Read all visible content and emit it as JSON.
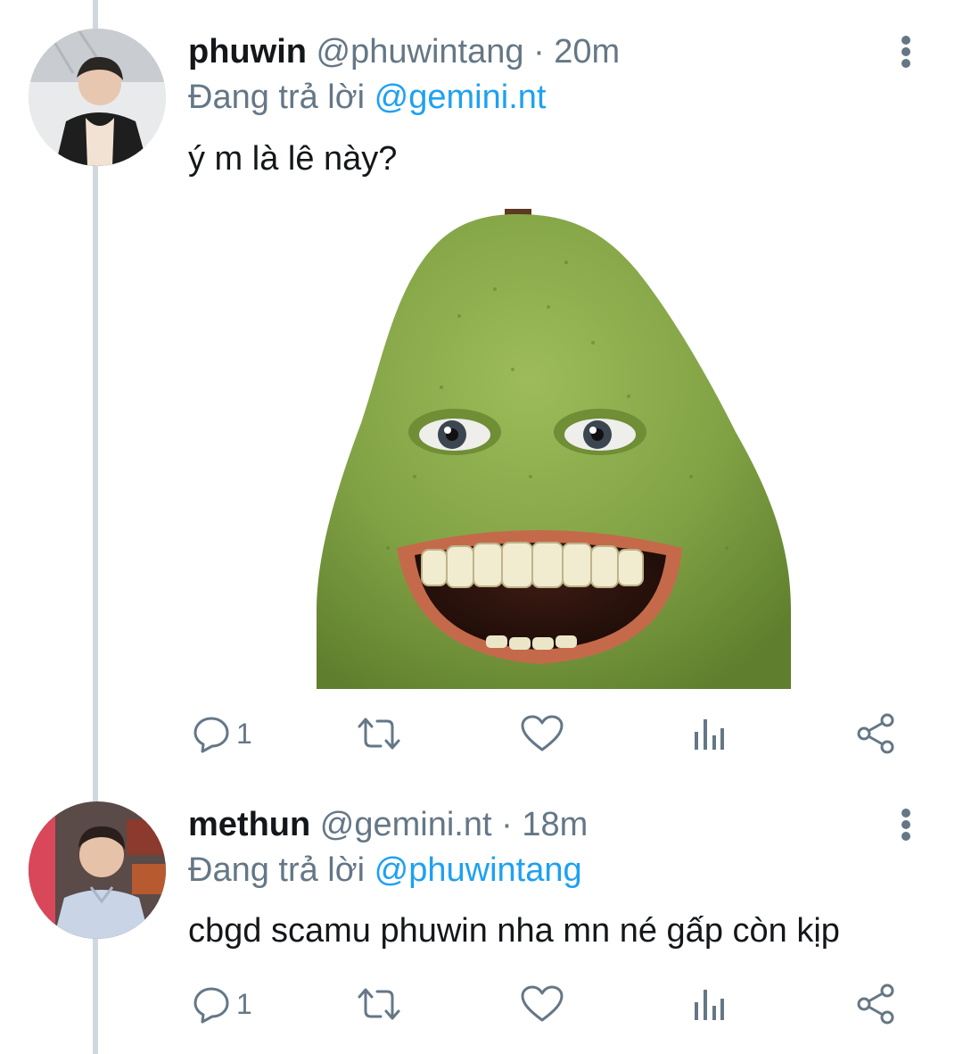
{
  "tweets": [
    {
      "name": "phuwin",
      "handle": "@phuwintang",
      "separator": "·",
      "time": "20m",
      "reply_prefix": "Đang trả lời",
      "reply_to": "@gemini.nt",
      "text": "ý m là lê này?",
      "avatar_icon": "avatar-photo",
      "media_icon": "smiling-pear-image",
      "reply_count": "1",
      "actions": [
        "reply-icon",
        "retweet-icon",
        "like-icon",
        "analytics-icon",
        "share-icon"
      ]
    },
    {
      "name": "methun",
      "handle": "@gemini.nt",
      "separator": "·",
      "time": "18m",
      "reply_prefix": "Đang trả lời",
      "reply_to": "@phuwintang",
      "text": "cbgd scamu phuwin nha mn né gấp còn kịp",
      "avatar_icon": "avatar-photo",
      "reply_count": "1",
      "actions": [
        "reply-icon",
        "retweet-icon",
        "like-icon",
        "analytics-icon",
        "share-icon"
      ]
    }
  ],
  "colors": {
    "text_primary": "#14171a",
    "text_secondary": "#657786",
    "link": "#1da1f2",
    "thread_line": "#cfd9de",
    "icon": "#657786"
  }
}
